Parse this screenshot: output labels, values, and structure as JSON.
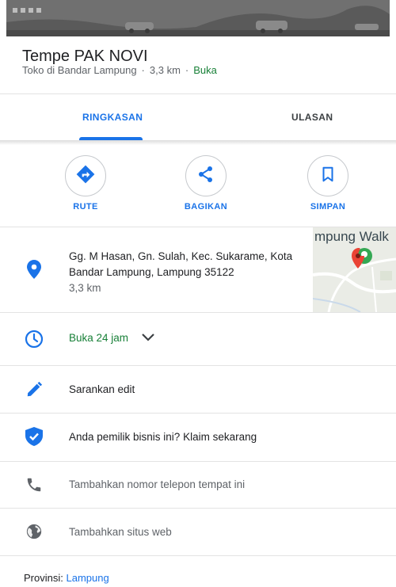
{
  "place": {
    "name": "Tempe PAK NOVI",
    "category": "Toko di Bandar Lampung",
    "distance": "3,3 km",
    "status": "Buka"
  },
  "tabs": [
    {
      "label": "RINGKASAN",
      "active": true
    },
    {
      "label": "ULASAN",
      "active": false
    }
  ],
  "actions": {
    "route": "RUTE",
    "share": "BAGIKAN",
    "save": "SIMPAN"
  },
  "address": {
    "line1": "Gg. M Hasan, Gn. Sulah, Kec. Sukarame, Kota",
    "line2": "Bandar Lampung, Lampung 35122",
    "distance": "3,3 km"
  },
  "map_thumbnail": {
    "label": "mpung Walk"
  },
  "hours": {
    "label": "Buka 24 jam"
  },
  "suggest_edit": {
    "label": "Sarankan edit"
  },
  "claim": {
    "label": "Anda pemilik bisnis ini? Klaim sekarang"
  },
  "phone": {
    "placeholder": "Tambahkan nomor telepon tempat ini"
  },
  "website": {
    "placeholder": "Tambahkan situs web"
  },
  "province": {
    "label": "Provinsi:",
    "value": "Lampung"
  },
  "icons": {
    "route": "directions-icon",
    "share": "share-icon",
    "save": "bookmark-icon",
    "address": "location-pin-icon",
    "hours": "clock-icon",
    "edit": "pencil-icon",
    "claim": "verified-shield-icon",
    "phone": "phone-icon",
    "website": "globe-icon"
  },
  "colors": {
    "accent": "#1a73e8",
    "open_green": "#188038",
    "muted_icon": "#5f6368"
  }
}
